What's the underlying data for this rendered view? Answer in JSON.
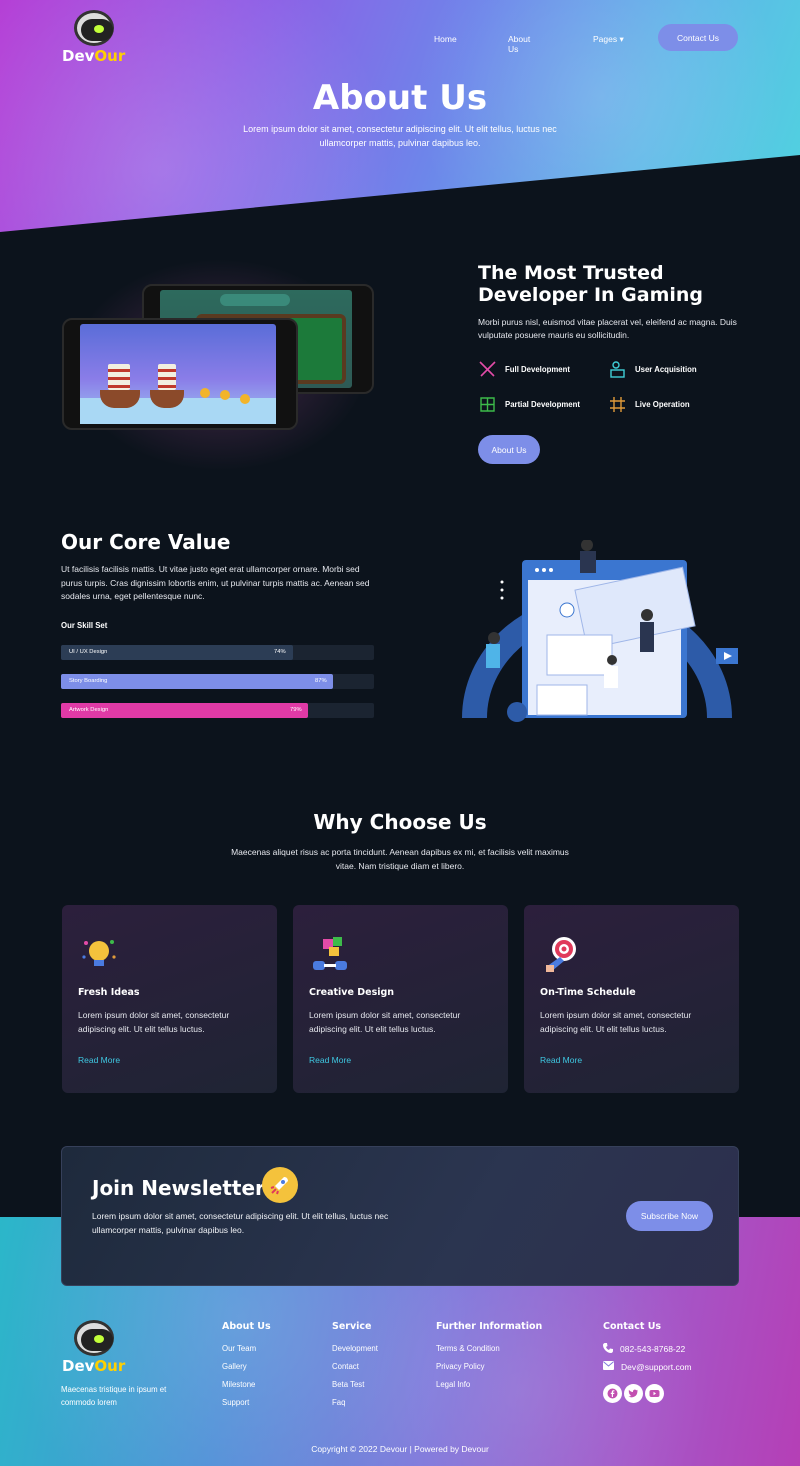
{
  "brand": {
    "name_part1": "Dev",
    "name_part2": "Our"
  },
  "nav": {
    "home": "Home",
    "about": "About Us",
    "pages": "Pages",
    "pages_caret": "▾",
    "contact": "Contact Us"
  },
  "hero": {
    "title": "About Us",
    "subtitle": "Lorem ipsum dolor sit amet, consectetur adipiscing elit. Ut elit tellus, luctus nec ullamcorper mattis, pulvinar dapibus leo."
  },
  "trusted": {
    "title_line1": "The Most Trusted",
    "title_line2": "Developer In Gaming",
    "text": "Morbi purus nisl, euismod vitae placerat vel, eleifend ac magna. Duis vulputate posuere mauris eu sollicitudin.",
    "features": [
      {
        "label": "Full Development",
        "icon": "swords-icon",
        "color": "#e24ba7"
      },
      {
        "label": "User Acquisition",
        "icon": "user-desk-icon",
        "color": "#3fd0d8"
      },
      {
        "label": "Partial Development",
        "icon": "grid-icon",
        "color": "#3dbb4a"
      },
      {
        "label": "Live Operation",
        "icon": "hashgrid-icon",
        "color": "#e09a3a"
      }
    ],
    "button": "About Us"
  },
  "core": {
    "title": "Our Core Value",
    "text": "Ut facilisis facilisis mattis. Ut vitae justo eget erat ullamcorper ornare. Morbi sed purus turpis. Cras dignissim lobortis enim, ut pulvinar turpis mattis ac. Aenean sed sodales urna, eget pellentesque nunc.",
    "skill_heading": "Our Skill Set",
    "skills": [
      {
        "label": "UI / UX Design",
        "percent_text": "74%",
        "value": 74,
        "color": "#2c3d55"
      },
      {
        "label": "Story Boarding",
        "percent_text": "87%",
        "value": 87,
        "color": "#7d8ee8"
      },
      {
        "label": "Artwork Design",
        "percent_text": "79%",
        "value": 79,
        "color": "#e03aa6"
      }
    ]
  },
  "why": {
    "title": "Why Choose Us",
    "subtitle": "Maecenas aliquet risus ac porta tincidunt. Aenean dapibus ex mi, et facilisis velit maximus vitae. Nam tristique diam et libero.",
    "cards": [
      {
        "title": "Fresh Ideas",
        "text": "Lorem ipsum dolor sit amet, consectetur adipiscing elit. Ut elit tellus luctus.",
        "link": "Read More",
        "icon": "lightbulb-icon"
      },
      {
        "title": "Creative Design",
        "text": "Lorem ipsum dolor sit amet, consectetur adipiscing elit. Ut elit tellus luctus.",
        "link": "Read More",
        "icon": "puzzle-icon"
      },
      {
        "title": "On-Time Schedule",
        "text": "Lorem ipsum dolor sit amet, consectetur adipiscing elit. Ut elit tellus luctus.",
        "link": "Read More",
        "icon": "target-icon"
      }
    ]
  },
  "newsletter": {
    "title": "Join Newsletter",
    "text": "Lorem ipsum dolor sit amet, consectetur adipiscing elit. Ut elit tellus, luctus nec ullamcorper mattis, pulvinar dapibus leo.",
    "button": "Subscribe Now"
  },
  "footer": {
    "description": "Maecenas tristique in ipsum et commodo lorem",
    "columns": [
      {
        "heading": "About Us",
        "links": [
          "Our Team",
          "Gallery",
          "Milestone",
          "Support"
        ]
      },
      {
        "heading": "Service",
        "links": [
          "Development",
          "Contact",
          "Beta Test",
          "Faq"
        ]
      },
      {
        "heading": "Further Information",
        "links": [
          "Terms & Condition",
          "Privacy Policy",
          "Legal Info"
        ]
      }
    ],
    "contact_heading": "Contact Us",
    "phone": "082-543-8768-22",
    "email": "Dev@support.com",
    "copyright": "Copyright © 2022 Devour | Powered by Devour"
  }
}
